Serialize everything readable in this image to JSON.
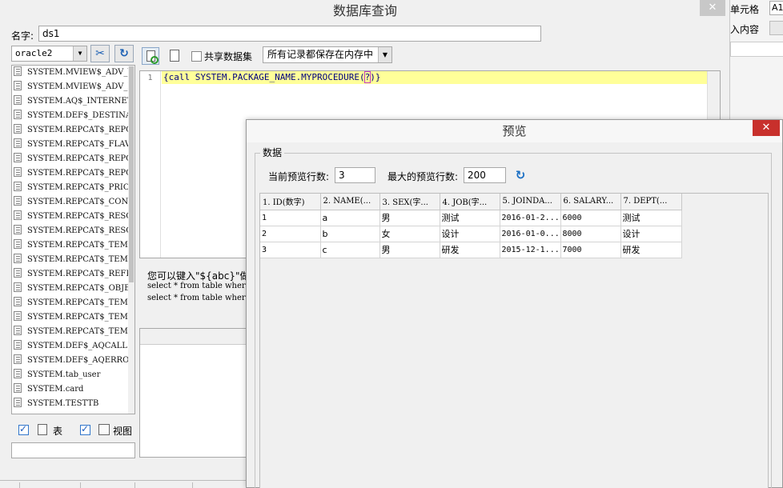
{
  "main_dialog": {
    "title": "数据库查询",
    "close": "✕",
    "name_label": "名字:",
    "name_value": "ds1"
  },
  "left_panel": {
    "connection": "oracle2",
    "tables": [
      "SYSTEM.MVIEW$_ADV_WORKLOAD",
      "SYSTEM.MVIEW$_ADV_LOG",
      "SYSTEM.AQ$_INTERNET_AGENTS",
      "SYSTEM.DEF$_DESTINATION",
      "SYSTEM.REPCAT$_REPCAT",
      "SYSTEM.REPCAT$_FLAVORS",
      "SYSTEM.REPCAT$_REPOBJECT",
      "SYSTEM.REPCAT$_REPCATLOG",
      "SYSTEM.REPCAT$_PRIORITY",
      "SYSTEM.REPCAT$_CONFLICT",
      "SYSTEM.REPCAT$_RESOLUTION",
      "SYSTEM.REPCAT$_RESOLUTION_METHOD",
      "SYSTEM.REPCAT$_TEMPLATE_OBJECTS",
      "SYSTEM.REPCAT$_TEMPLATE_PARMS",
      "SYSTEM.REPCAT$_REFRESH_TEMPLATES",
      "SYSTEM.REPCAT$_OBJECT_PARMS",
      "SYSTEM.REPCAT$_TEMPLATE_SITES",
      "SYSTEM.REPCAT$_TEMPLATE_TARGETS",
      "SYSTEM.REPCAT$_TEMPLATE_STATUS",
      "SYSTEM.DEF$_AQCALL",
      "SYSTEM.DEF$_AQERROR",
      "SYSTEM.tab_user",
      "SYSTEM.card",
      "SYSTEM.TESTTB"
    ],
    "show_tables_label": "表",
    "show_views_label": "视图"
  },
  "toolbar": {
    "share_label": "共享数据集",
    "memory_option": "所有记录都保存在内存中"
  },
  "editor": {
    "line_number": "1",
    "code_before": "{call SYSTEM.PACKAGE_NAME.MYPROCEDURE(",
    "code_cursor": "?",
    "code_after": ")}"
  },
  "hint": {
    "text": "您可以键入\"${abc}\"做为参数",
    "sample1": "select * from table where id=${abc}",
    "sample2": "select * from table where id='${abc}'"
  },
  "preview_dialog": {
    "title": "预览",
    "close": "✕",
    "group_label": "数据",
    "current_rows_label": "当前预览行数:",
    "current_rows_value": "3",
    "max_rows_label": "最大的预览行数:",
    "max_rows_value": "200",
    "columns": [
      "1. ID(数字)",
      "2. NAME(...",
      "3. SEX(字...",
      "4. JOB(字...",
      "5. JOINDA...",
      "6. SALARY...",
      "7. DEPT(..."
    ],
    "rows": [
      [
        "1",
        "a",
        "男",
        "测试",
        "2016-01-2...",
        "6000",
        "测试"
      ],
      [
        "2",
        "b",
        "女",
        "设计",
        "2016-01-0...",
        "8000",
        "设计"
      ],
      [
        "3",
        "c",
        "男",
        "研发",
        "2015-12-1...",
        "7000",
        "研发"
      ]
    ]
  },
  "background": {
    "label1": "单元格",
    "value1": "A1",
    "label2": "入内容"
  }
}
